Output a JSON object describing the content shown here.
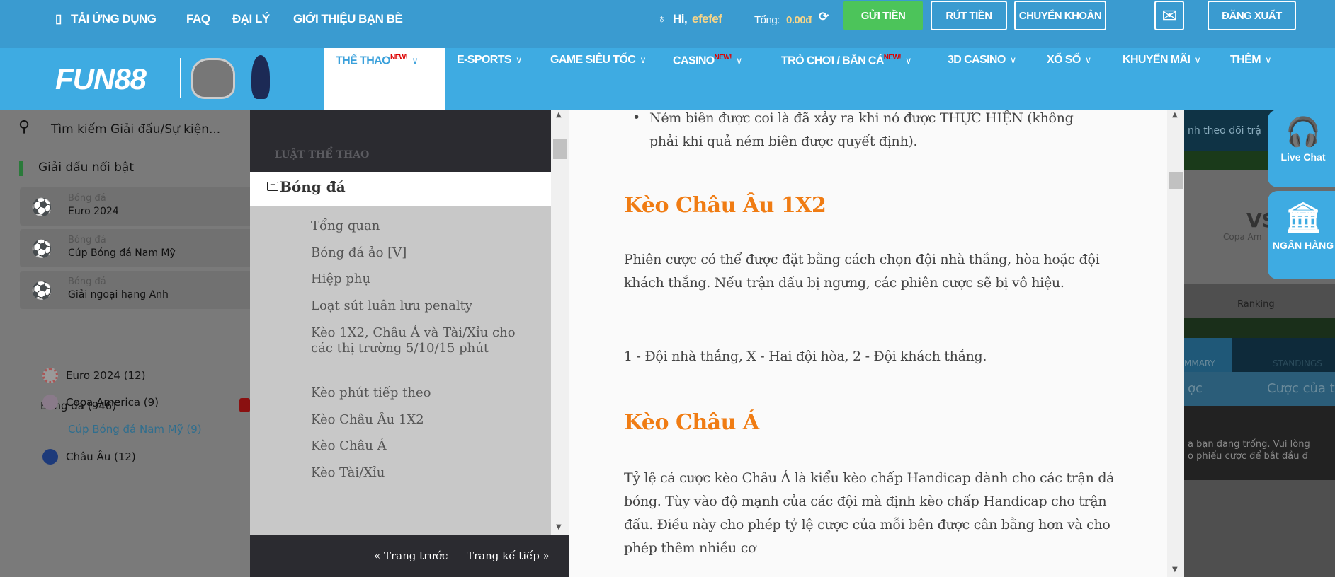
{
  "topbar": {
    "links": [
      "TẢI ỨNG DỤNG",
      "FAQ",
      "ĐẠI LÝ",
      "GIỚI THIỆU BẠN BÈ"
    ],
    "greeting": "Hi,",
    "username": "efefef",
    "total_label": "Tổng:",
    "total_value": "0.00đ",
    "deposit": "GỬI TIỀN",
    "withdraw": "RÚT TIỀN",
    "transfer": "CHUYỂN KHOẢN",
    "logout": "ĐĂNG XUẤT",
    "deposit_color": "#4cc45a"
  },
  "logo": "FUN88",
  "nav": {
    "new_badge": "NEW!",
    "items": [
      "THỂ THAO",
      "E-SPORTS",
      "GAME SIÊU TỐC",
      "CASINO",
      "TRÒ CHƠI / BẮN CÁ",
      "3D CASINO",
      "XỔ SỐ",
      "KHUYẾN MÃI",
      "THÊM"
    ]
  },
  "sidebar": {
    "search_placeholder": "Tìm kiếm Giải đấu/Sự kiện...",
    "featured_title": "Giải đấu nổi bật",
    "featured": [
      {
        "sport": "Bóng đá",
        "name": "Euro 2024"
      },
      {
        "sport": "Bóng đá",
        "name": "Cúp Bóng đá Nam Mỹ"
      },
      {
        "sport": "Bóng đá",
        "name": "Giải ngoại hạng Anh"
      }
    ],
    "sport_header": "Bóng đá  (946)",
    "leagues": [
      "Euro 2024 (12)",
      "Copa America (9)",
      "Cúp Bóng đá Nam Mỹ (9)",
      "Châu Âu (12)"
    ]
  },
  "rules": {
    "section": "LUẬT THỂ THAO",
    "category": "Bóng đá",
    "items": [
      "Tổng quan",
      "Bóng đá ảo [V]",
      "Hiệp phụ",
      "Loạt sút luân lưu penalty",
      "Kèo 1X2, Châu Á và Tài/Xỉu cho các thị trường 5/10/15 phút",
      "Kèo phút tiếp theo",
      "Kèo Châu Âu 1X2",
      "Kèo Châu Á",
      "Kèo Tài/Xỉu"
    ],
    "prev": "« Trang trước",
    "next": "Trang kế tiếp »"
  },
  "content": {
    "bullet": "Ném biên được coi là đã xảy ra khi nó được THỰC HIỆN (không phải khi quả ném biên được quyết định).",
    "h1": "Kèo Châu Âu 1X2",
    "p1": "Phiên cược có thể được đặt bằng cách chọn đội nhà thắng, hòa hoặc đội khách thắng. Nếu trận đấu bị ngưng, các phiên cược sẽ bị vô hiệu.",
    "p2": "1 - Đội nhà thắng, X - Hai đội hòa, 2 - Đội khách thắng.",
    "h2": "Kèo Châu Á",
    "p3": "Tỷ lệ cá cược kèo Châu Á là kiểu kèo chấp Handicap dành cho các trận đá bóng. Tùy vào độ mạnh của các đội mà định kèo chấp Handicap cho trận đấu. Điều này cho phép tỷ lệ cược của mỗi bên được cân bằng hơn và cho phép thêm nhiều cơ"
  },
  "behind": {
    "follow": "nh theo dõi trậ",
    "vs": "VS",
    "league": "Copa Am",
    "ranking": "Ranking",
    "summary": "MMARY",
    "standings": "STANDINGS",
    "bet_tab1": "ợc",
    "bet_tab2": "Cược của t",
    "empty1": "a bạn đang trống. Vui lòng",
    "empty2": "o phiếu cược để bắt đầu đ"
  },
  "floats": {
    "chat": "Live Chat",
    "bank": "NGÂN HÀNG"
  }
}
